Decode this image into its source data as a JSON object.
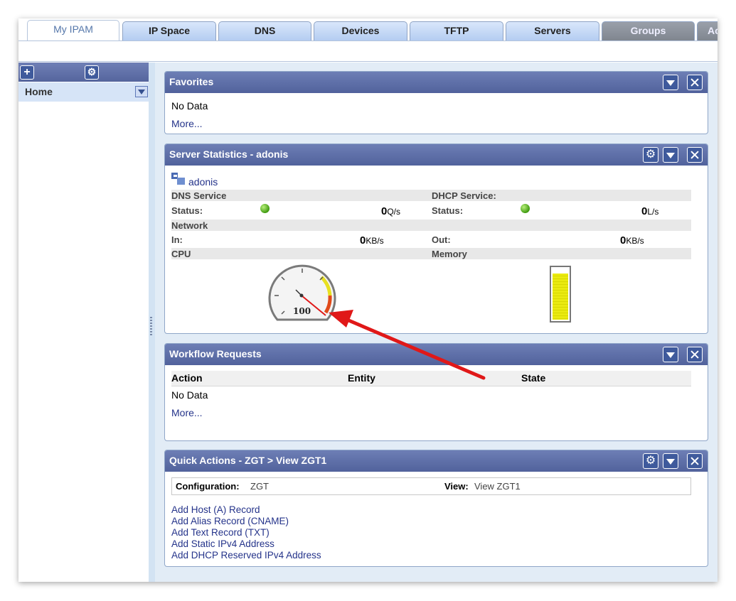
{
  "tabs": [
    "My IPAM",
    "IP Space",
    "DNS",
    "Devices",
    "TFTP",
    "Servers",
    "Groups",
    "Ac"
  ],
  "sidebar": {
    "home_label": "Home",
    "add_icon": "plus-icon",
    "settings_icon": "gear-icon"
  },
  "favorites": {
    "title": "Favorites",
    "no_data": "No Data",
    "more": "More..."
  },
  "server_stats": {
    "title": "Server Statistics - adonis",
    "server_name": "adonis",
    "dns_service": "DNS Service",
    "dhcp_service": "DHCP Service:",
    "status_label": "Status:",
    "dns_value": "0",
    "dns_unit": "Q/s",
    "dhcp_value": "0",
    "dhcp_unit": "L/s",
    "network": "Network",
    "in_label": "In:",
    "in_value": "0",
    "in_unit": "KB/s",
    "out_label": "Out:",
    "out_value": "0",
    "out_unit": "KB/s",
    "cpu": "CPU",
    "memory": "Memory",
    "cpu_gauge_label": "100",
    "memory_fill_fraction": 0.85,
    "status_color": "#3f9a10"
  },
  "workflow": {
    "title": "Workflow Requests",
    "columns": [
      "Action",
      "Entity",
      "State"
    ],
    "no_data": "No Data",
    "more": "More..."
  },
  "quick_actions": {
    "title": "Quick Actions - ZGT > View ZGT1",
    "configuration_label": "Configuration:",
    "configuration_value": "ZGT",
    "view_label": "View:",
    "view_value": "View ZGT1",
    "links": [
      "Add Host (A) Record",
      "Add Alias Record (CNAME)",
      "Add Text Record (TXT)",
      "Add Static IPv4 Address",
      "Add DHCP Reserved IPv4 Address"
    ]
  },
  "annotation_color": "#e01818"
}
